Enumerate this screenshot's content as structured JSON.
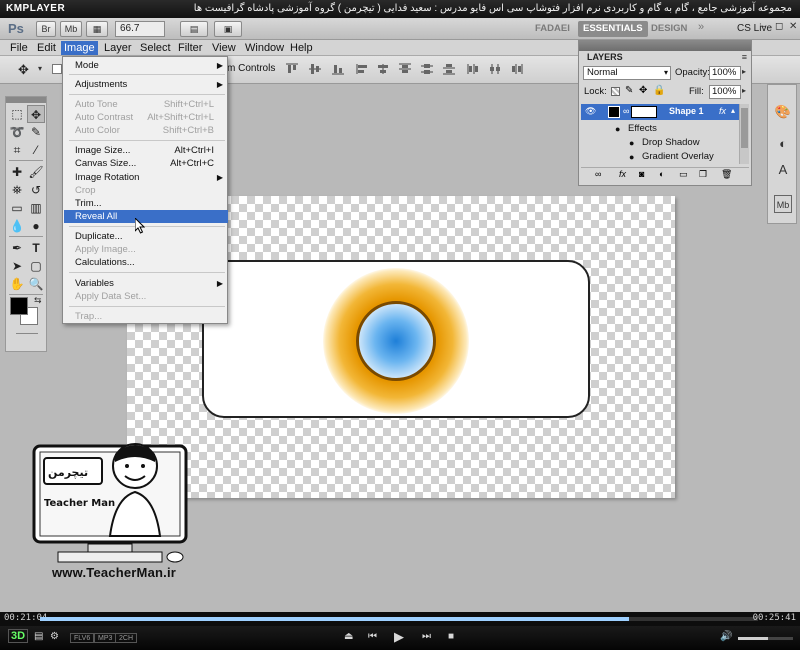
{
  "player": {
    "brand": "KMPLAYER",
    "video_title": "مجموعه آموزشی جامع ، گام به گام و کاربردی نرم افزار فتوشاپ سی اس فایو مدرس : سعید فدایی ( تیچرمن ) گروه آموزشی پادشاه گرافیست ها",
    "time_current": "00:21:04",
    "time_total": "00:25:41",
    "progress_fraction": 0.82,
    "volume_fraction": 0.55,
    "badges": [
      "FLV6",
      "MP3",
      "2CH"
    ],
    "mode_3d": "3D"
  },
  "appbar": {
    "ps_logo": "Ps",
    "zoom": "66.7",
    "workspaces": [
      "FADAEI",
      "ESSENTIALS",
      "DESIGN"
    ],
    "active_workspace": "ESSENTIALS",
    "cs_live": "CS Live"
  },
  "menubar": {
    "items": [
      "File",
      "Edit",
      "Image",
      "Layer",
      "Select",
      "Filter",
      "View",
      "Window",
      "Help"
    ],
    "active": "Image"
  },
  "optionsbar": {
    "transform_controls": "m Controls"
  },
  "image_menu": {
    "items": [
      {
        "label": "Mode",
        "submenu": true
      },
      {
        "label": "Adjustments",
        "submenu": true
      },
      {
        "label": "Auto Tone",
        "shortcut": "Shift+Ctrl+L",
        "disabled": true
      },
      {
        "label": "Auto Contrast",
        "shortcut": "Alt+Shift+Ctrl+L",
        "disabled": true
      },
      {
        "label": "Auto Color",
        "shortcut": "Shift+Ctrl+B",
        "disabled": true
      },
      {
        "label": "Image Size...",
        "shortcut": "Alt+Ctrl+I"
      },
      {
        "label": "Canvas Size...",
        "shortcut": "Alt+Ctrl+C"
      },
      {
        "label": "Image Rotation",
        "submenu": true
      },
      {
        "label": "Crop",
        "disabled": true
      },
      {
        "label": "Trim..."
      },
      {
        "label": "Reveal All",
        "highlighted": true
      },
      {
        "label": "Duplicate..."
      },
      {
        "label": "Apply Image...",
        "disabled": true
      },
      {
        "label": "Calculations..."
      },
      {
        "label": "Variables",
        "submenu": true
      },
      {
        "label": "Apply Data Set...",
        "disabled": true
      },
      {
        "label": "Trap...",
        "disabled": true
      }
    ]
  },
  "layers_panel": {
    "tab": "LAYERS",
    "blend_mode": "Normal",
    "opacity_label": "Opacity:",
    "opacity": "100%",
    "lock_label": "Lock:",
    "fill_label": "Fill:",
    "fill": "100%",
    "layer_name": "Shape 1",
    "effects_label": "Effects",
    "effects": [
      "Drop Shadow",
      "Gradient Overlay"
    ]
  },
  "watermark": {
    "name": "Teacher Man",
    "url": "www.TeacherMan.ir"
  },
  "colors": {
    "highlight": "#3a6fc8",
    "workspace_bg": "#b9b9b9",
    "glow": "#e69600",
    "orb_center": "#1e7fd8"
  }
}
